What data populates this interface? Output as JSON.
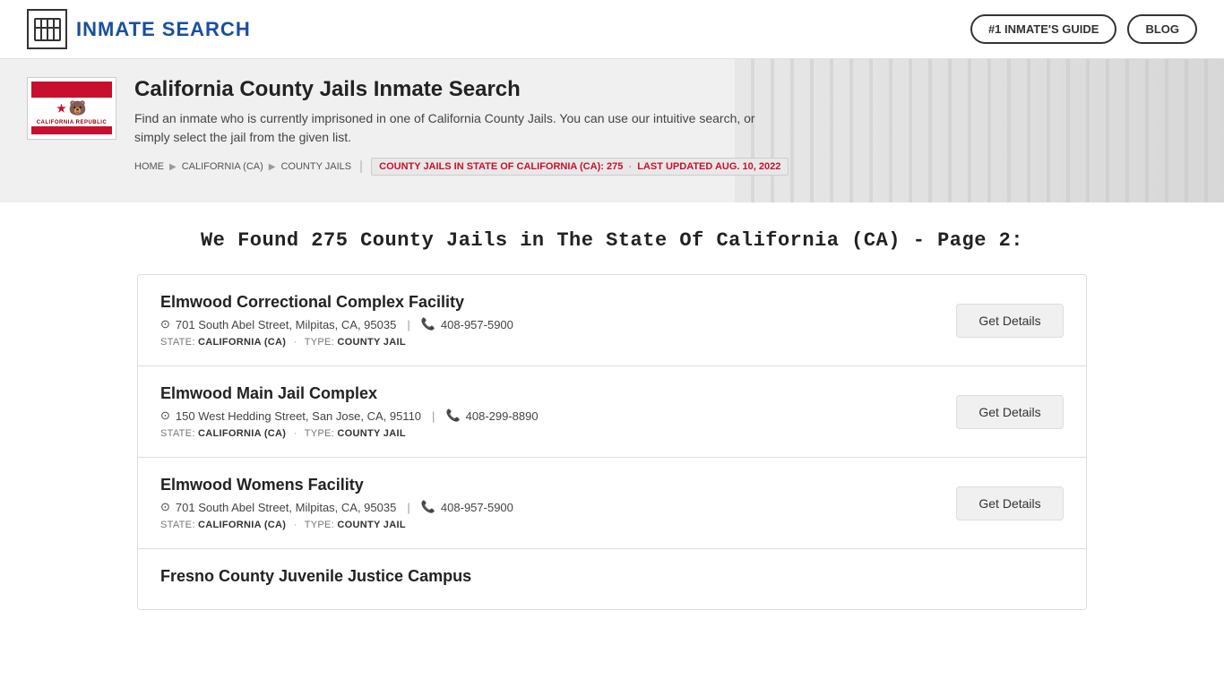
{
  "header": {
    "title": "INMATE SEARCH",
    "logo_symbol": "⊞",
    "nav": [
      {
        "label": "#1 INMATE'S GUIDE",
        "id": "inmates-guide"
      },
      {
        "label": "BLOG",
        "id": "blog"
      }
    ]
  },
  "hero": {
    "flag_label": "CALIFORNIA REPUBLIC",
    "title": "California County Jails Inmate Search",
    "description": "Find an inmate who is currently imprisoned in one of California County Jails. You can use our intuitive search, or simply select the jail from the given list.",
    "breadcrumb": {
      "home": "HOME",
      "state": "CALIFORNIA (CA)",
      "section": "COUNTY JAILS",
      "info_text": "COUNTY JAILS IN STATE OF CALIFORNIA (CA):",
      "count": "275",
      "updated_label": "LAST UPDATED AUG. 10, 2022"
    }
  },
  "main": {
    "heading": "We Found 275 County Jails in The State Of California (CA) - Page 2:",
    "results": [
      {
        "id": 1,
        "name": "Elmwood Correctional Complex Facility",
        "address": "701 South Abel Street, Milpitas, CA, 95035",
        "phone": "408-957-5900",
        "state_label": "STATE:",
        "state_value": "CALIFORNIA (CA)",
        "type_label": "TYPE:",
        "type_value": "COUNTY JAIL",
        "btn_label": "Get Details"
      },
      {
        "id": 2,
        "name": "Elmwood Main Jail Complex",
        "address": "150 West Hedding Street, San Jose, CA, 95110",
        "phone": "408-299-8890",
        "state_label": "STATE:",
        "state_value": "CALIFORNIA (CA)",
        "type_label": "TYPE:",
        "type_value": "COUNTY JAIL",
        "btn_label": "Get Details"
      },
      {
        "id": 3,
        "name": "Elmwood Womens Facility",
        "address": "701 South Abel Street, Milpitas, CA, 95035",
        "phone": "408-957-5900",
        "state_label": "STATE:",
        "state_value": "CALIFORNIA (CA)",
        "type_label": "TYPE:",
        "type_value": "COUNTY JAIL",
        "btn_label": "Get Details"
      },
      {
        "id": 4,
        "name": "Fresno County Juvenile Justice Campus",
        "address": "",
        "phone": "",
        "state_label": "",
        "state_value": "",
        "type_label": "",
        "type_value": "",
        "btn_label": ""
      }
    ]
  }
}
